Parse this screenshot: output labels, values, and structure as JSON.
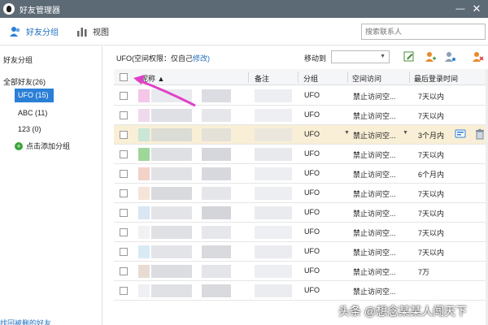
{
  "window": {
    "title": "好友管理器",
    "minimize_glyph": "—",
    "close_glyph": "✕"
  },
  "toolbar": {
    "friends_group_label": "好友分组",
    "view_label": "视图"
  },
  "search": {
    "placeholder": "搜索联系人"
  },
  "sidebar": {
    "heading": "好友分组",
    "groups": [
      {
        "label": "全部好友(26)"
      },
      {
        "label": "UFO (15)",
        "selected": true
      },
      {
        "label": "ABC (11)"
      },
      {
        "label": "123 (0)"
      }
    ],
    "add_group_label": "点击添加分组",
    "retrieve_label": "找回被删的好友"
  },
  "infobar": {
    "permission_prefix": "UFO(空间权限：仅自己",
    "permission_link": "修改)",
    "move_to_label": "移动到"
  },
  "table": {
    "columns": [
      "昵称 ▲",
      "备注",
      "分组",
      "空间访问",
      "最后登录时间"
    ],
    "rows": [
      {
        "group": "UFO",
        "space": "禁止访问空...",
        "last_login": "7天以内",
        "highlight": false
      },
      {
        "group": "UFO",
        "space": "禁止访问空...",
        "last_login": "7天以内",
        "highlight": false
      },
      {
        "group": "UFO",
        "space": "禁止访问空...",
        "last_login": "3个月内",
        "highlight": true
      },
      {
        "group": "UFO",
        "space": "禁止访问空...",
        "last_login": "7天以内",
        "highlight": false
      },
      {
        "group": "UFO",
        "space": "禁止访问空...",
        "last_login": "6个月内",
        "highlight": false
      },
      {
        "group": "UFO",
        "space": "禁止访问空...",
        "last_login": "7天以内",
        "highlight": false
      },
      {
        "group": "UFO",
        "space": "禁止访问空...",
        "last_login": "7天以内",
        "highlight": false
      },
      {
        "group": "UFO",
        "space": "禁止访问空...",
        "last_login": "7天以内",
        "highlight": false
      },
      {
        "group": "UFO",
        "space": "禁止访问空...",
        "last_login": "7天以内",
        "highlight": false
      },
      {
        "group": "UFO",
        "space": "禁止访问空...",
        "last_login": "7万",
        "highlight": false
      },
      {
        "group": "UFO",
        "space": "禁止访问空...",
        "last_login": "",
        "highlight": false
      }
    ]
  },
  "watermark": "头条 @想念某某人闯天下",
  "colors": {
    "accent": "#2b7fd6",
    "titlebar": "#5c6a76",
    "highlight_row": "#f9efd6",
    "arrow": "#e040c8"
  },
  "icons": [
    "qq-penguin-icon",
    "friends-group-icon",
    "view-icon",
    "edit-icon",
    "add-user-icon",
    "user-settings-icon",
    "delete-user-icon",
    "chat-icon",
    "trash-icon"
  ]
}
